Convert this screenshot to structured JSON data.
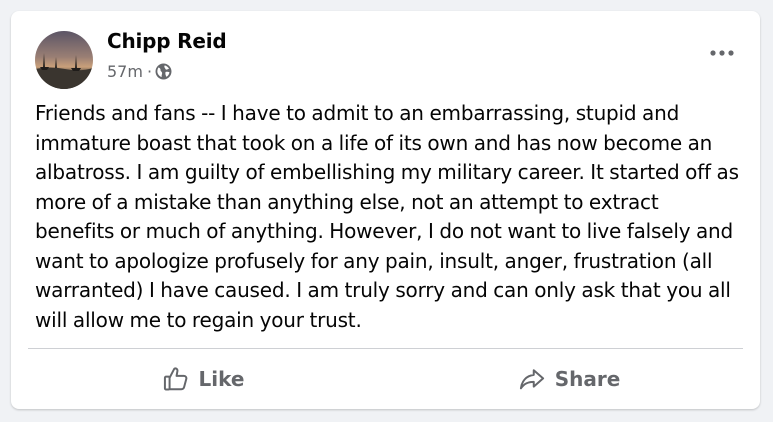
{
  "post": {
    "author": "Chipp Reid",
    "time": "57m",
    "separator": "·",
    "privacy_icon": "globe-icon",
    "more_icon": "more-options-icon",
    "text": "Friends and fans -- I have to admit to an embarrassing, stupid and immature boast that took on a life of its own and has now become an albatross. I am guilty of embellishing my military career. It started off as more of a mistake than anything else, not an attempt to extract benefits or much of anything. However, I do not want to live falsely and want to apologize profusely for any pain, insult, anger, frustration (all warranted) I have caused. I am truly sorry and can only ask that you all will allow me to regain your trust."
  },
  "actions": {
    "like_label": "Like",
    "like_icon": "thumbs-up-icon",
    "share_label": "Share",
    "share_icon": "share-arrow-icon"
  },
  "colors": {
    "background": "#f0f2f5",
    "card": "#ffffff",
    "primary_text": "#050505",
    "secondary_text": "#65676b"
  }
}
